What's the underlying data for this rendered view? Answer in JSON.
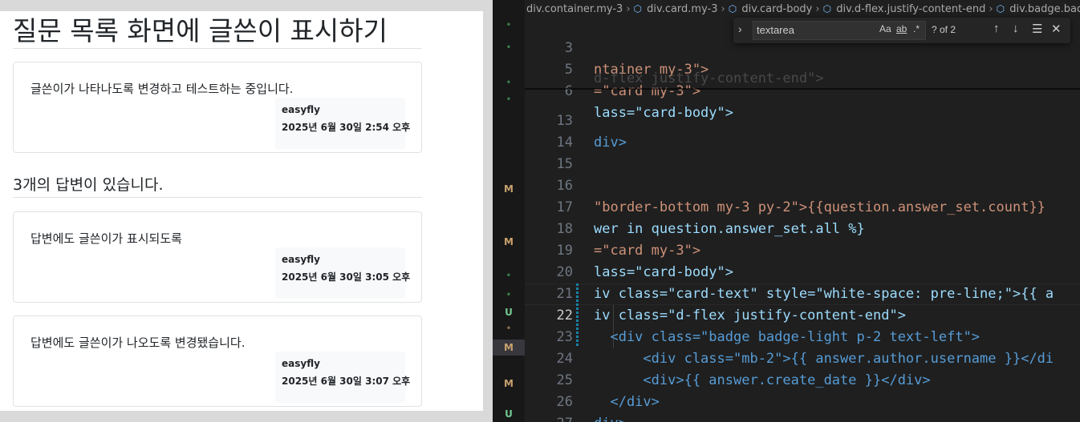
{
  "browser": {
    "page_title": "질문 목록 화면에 글쓴이 표시하기",
    "question": {
      "content": "글쓴이가 나타나도록 변경하고 테스트하는 중입니다.",
      "author": "easyfly",
      "date": "2025년 6월 30일 2:54 오후"
    },
    "answer_count_text": "3개의 답변이 있습니다.",
    "answers": [
      {
        "content": "답변에도 글쓴이가 표시되도록",
        "author": "easyfly",
        "date": "2025년 6월 30일 3:05 오후"
      },
      {
        "content": "답변에도 글쓴이가 나오도록 변경됐습니다.",
        "author": "easyfly",
        "date": "2025년 6월 30일 3:07 오후"
      }
    ]
  },
  "editor": {
    "breadcrumb": [
      "div.container.my-3",
      "div.card.my-3",
      "div.card-body",
      "div.d-flex.justify-content-end",
      "div.badge.badge-ligh"
    ],
    "find": {
      "query": "textarea",
      "match_case_label": "Aa",
      "whole_word_label": "ab",
      "regex_label": ".*",
      "result": "? of 2",
      "toggle_icon": "chevron-right-icon",
      "prev_icon": "arrow-up-icon",
      "next_icon": "arrow-down-icon",
      "selection_icon": "find-in-selection-icon",
      "close_icon": "close-icon"
    },
    "ghost_line": "d-flex justify-content-end\">",
    "sticky_lines": [
      {
        "num": "3",
        "code": "ntainer my-3\">"
      },
      {
        "num": "5",
        "code": "=\"card my-3\">"
      },
      {
        "num": "6",
        "code": "lass=\"card-body\">"
      }
    ],
    "lines": [
      {
        "num": "13",
        "code": "div>"
      },
      {
        "num": "14",
        "code": ""
      },
      {
        "num": "15",
        "code": ""
      },
      {
        "num": "16",
        "code": "\"border-bottom my-3 py-2\">{{question.answer_set.count}}"
      },
      {
        "num": "17",
        "code": "wer in question.answer_set.all %}"
      },
      {
        "num": "18",
        "code": "=\"card my-3\">"
      },
      {
        "num": "19",
        "code": "lass=\"card-body\">"
      },
      {
        "num": "20",
        "code": "iv class=\"card-text\" style=\"white-space: pre-line;\">{{ a"
      },
      {
        "num": "21",
        "code": "iv class=\"d-flex justify-content-end\">"
      },
      {
        "num": "22",
        "code": "  <div class=\"badge badge-light p-2 text-left\">"
      },
      {
        "num": "23",
        "code": "      <div class=\"mb-2\">{{ answer.author.username }}</di"
      },
      {
        "num": "24",
        "code": "      <div>{{ answer.create_date }}</div>"
      },
      {
        "num": "25",
        "code": "  </div>"
      },
      {
        "num": "26",
        "code": "div>"
      },
      {
        "num": "27",
        "code": ""
      }
    ],
    "active_line": "22",
    "scm_markers": [
      "•",
      "•",
      "•",
      "•",
      "M",
      "M",
      "•",
      "•",
      "U",
      "•",
      "M",
      "M",
      "U"
    ]
  },
  "colors": {
    "string": "#ce9178",
    "attribute": "#9cdcfe",
    "tag": "#569cd6",
    "scm_modified": "#c9a26d",
    "scm_untracked": "#73c991"
  }
}
